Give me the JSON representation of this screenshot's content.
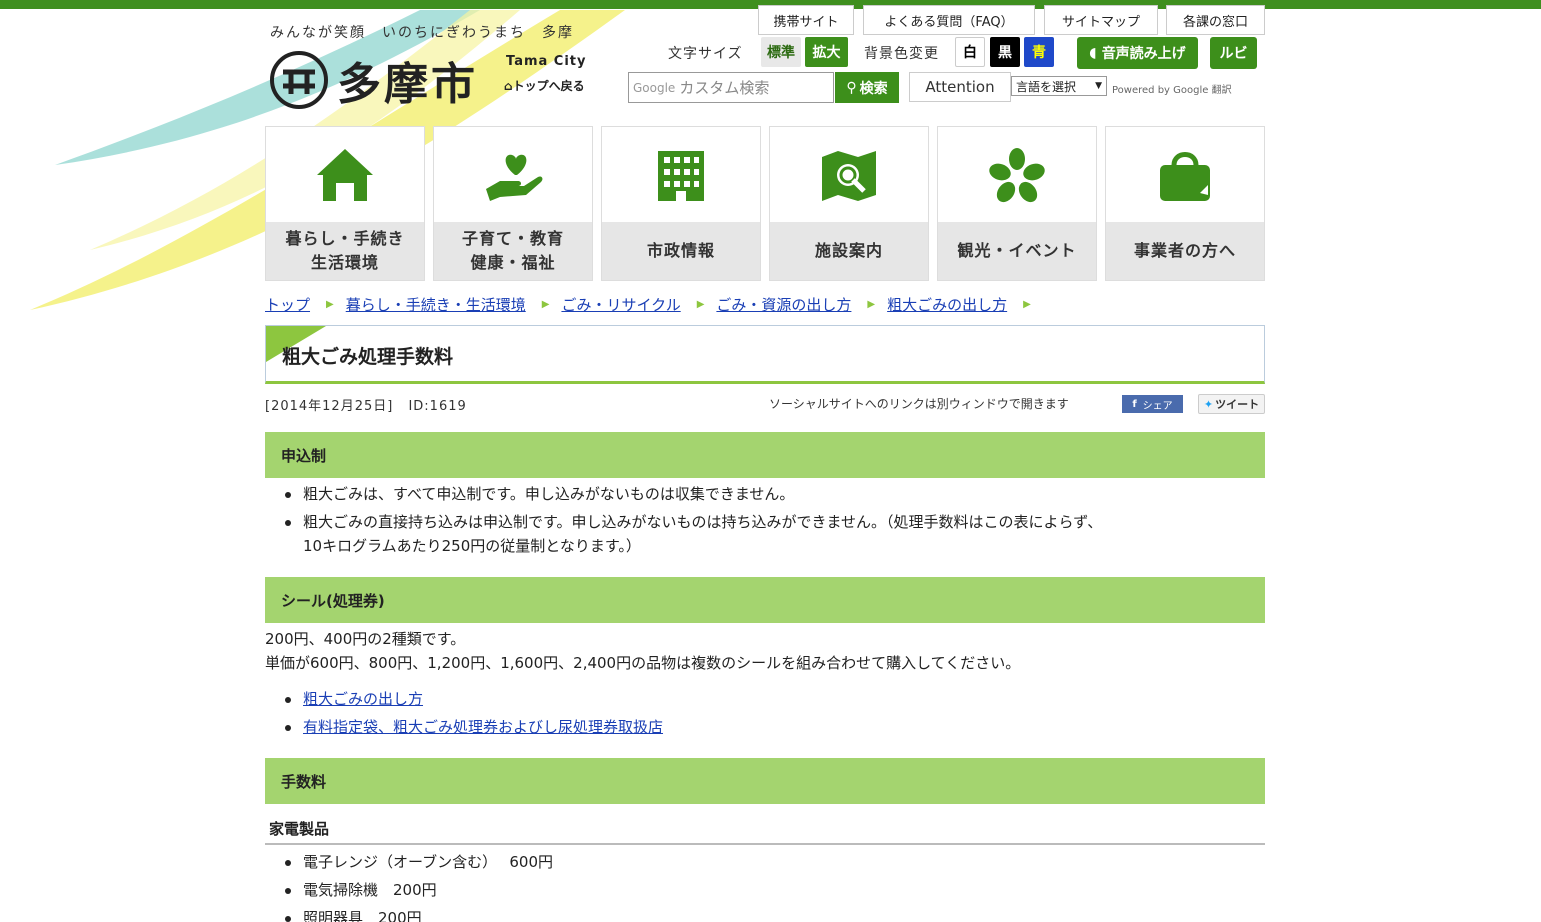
{
  "header": {
    "tagline": "みんなが笑顔　いのちにぎわうまち　多摩",
    "logo_text": "多摩市",
    "logo_en": "Tama City",
    "back_to_top": "トップへ戻る",
    "util_links": [
      "携帯サイト",
      "よくある質問（FAQ）",
      "サイトマップ",
      "各課の窓口"
    ],
    "font_size_label": "文字サイズ",
    "font_size_options": [
      "標準",
      "拡大"
    ],
    "bg_color_label": "背景色変更",
    "bg_color_options": [
      "白",
      "黒",
      "青"
    ],
    "voice_button": "音声読み上げ",
    "ruby_button": "ルビ",
    "search": {
      "logo": "Google",
      "placeholder": "カスタム検索",
      "button": "検索"
    },
    "attention": "Attention",
    "language_select": "言語を選択",
    "powered_by": "Powered by Google 翻訳"
  },
  "nav": [
    {
      "label": "暮らし・手続き\n生活環境",
      "icon": "house-icon"
    },
    {
      "label": "子育て・教育\n健康・福祉",
      "icon": "heart-hand-icon"
    },
    {
      "label": "市政情報",
      "icon": "building-icon"
    },
    {
      "label": "施設案内",
      "icon": "map-search-icon"
    },
    {
      "label": "観光・イベント",
      "icon": "cherry-blossom-icon"
    },
    {
      "label": "事業者の方へ",
      "icon": "bag-icon"
    }
  ],
  "breadcrumb": [
    "トップ",
    "暮らし・手続き・生活環境",
    "ごみ・リサイクル",
    "ごみ・資源の出し方",
    "粗大ごみの出し方"
  ],
  "page": {
    "title": "粗大ごみ処理手数料",
    "date": "[2014年12月25日]",
    "id": "ID:1619",
    "social_note": "ソーシャルサイトへのリンクは別ウィンドウで開きます",
    "share_label": "シェア",
    "tweet_label": "ツイート"
  },
  "sections": {
    "apply": {
      "heading": "申込制",
      "items": [
        "粗大ごみは、すべて申込制です。申し込みがないものは収集できません。",
        "粗大ごみの直接持ち込みは申込制です。申し込みがないものは持ち込みができません。（処理手数料はこの表によらず、",
        "10キログラムあたり250円の従量制となります。）"
      ]
    },
    "seal": {
      "heading": "シール(処理券)",
      "lines": [
        "200円、400円の2種類です。",
        "単価が600円、800円、1,200円、1,600円、2,400円の品物は複数のシールを組み合わせて購入してください。"
      ],
      "links": [
        "粗大ごみの出し方",
        "有料指定袋、粗大ごみ処理券およびし尿処理券取扱店"
      ]
    },
    "fee": {
      "heading": "手数料",
      "subheading": "家電製品",
      "items": [
        "電子レンジ（オーブン含む）　 600円",
        "電気掃除機　200円",
        "照明器具　200円"
      ]
    }
  },
  "colors": {
    "brand_green": "#3d8f1b",
    "section_bg": "#a4d46f",
    "link": "#1a3fb5"
  }
}
